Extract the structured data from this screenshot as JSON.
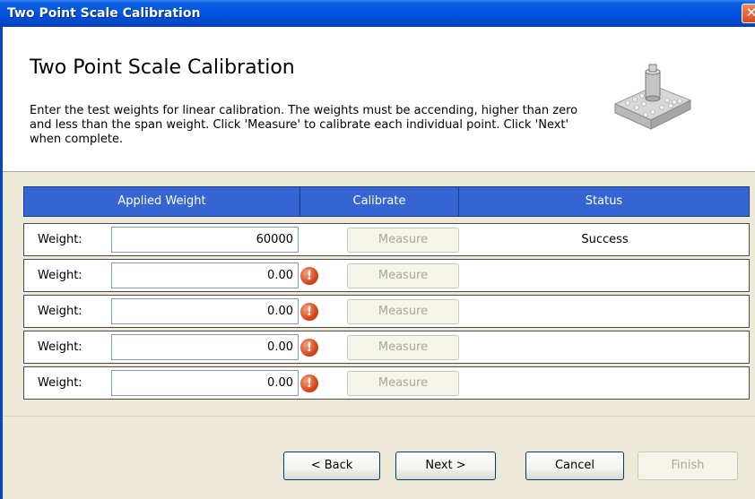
{
  "window": {
    "title": "Two Point Scale Calibration",
    "close_glyph": "✕"
  },
  "header": {
    "heading": "Two Point Scale Calibration",
    "description": "Enter the test weights for linear calibration. The weights must be accending, higher than zero and less than the span weight. Click 'Measure' to calibrate each individual point. Click 'Next' when complete.",
    "image_icon": "scale-weight-icon"
  },
  "table": {
    "columns": {
      "applied_weight": "Applied Weight",
      "calibrate": "Calibrate",
      "status": "Status"
    },
    "rows": [
      {
        "label": "Weight:",
        "value": "60000",
        "button": "Measure",
        "status": "Success",
        "error": false
      },
      {
        "label": "Weight:",
        "value": "0.00",
        "button": "Measure",
        "status": "",
        "error": true
      },
      {
        "label": "Weight:",
        "value": "0.00",
        "button": "Measure",
        "status": "",
        "error": true
      },
      {
        "label": "Weight:",
        "value": "0.00",
        "button": "Measure",
        "status": "",
        "error": true
      },
      {
        "label": "Weight:",
        "value": "0.00",
        "button": "Measure",
        "status": "",
        "error": true
      }
    ],
    "error_glyph": "!"
  },
  "buttons": {
    "back": "< Back",
    "next": "Next >",
    "cancel": "Cancel",
    "finish": "Finish"
  },
  "colors": {
    "titlebar": "#0055E5",
    "table_header": "#3465D2",
    "dialog_bg": "#ECE9D8",
    "error": "#D6461A"
  }
}
